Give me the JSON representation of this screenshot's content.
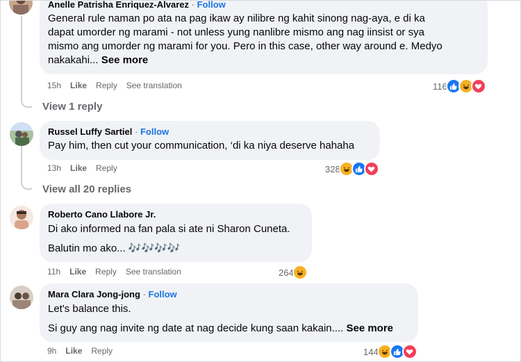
{
  "comments": [
    {
      "author": "Anelle Patrisha Enriquez-Alvarez",
      "dot": "·",
      "follow": "Follow",
      "lines": [
        "General rule naman po ata na pag ikaw ay nilibre ng kahit sinong nag-aya, e di ka",
        "dapat umorder ng marami - not unless yung nanlibre mismo ang nag iinsist or sya",
        "mismo ang umorder ng marami for you. Pero in this case, other way around e. Medyo",
        "nakakahi..."
      ],
      "see_more": "See more",
      "time": "15h",
      "like": "Like",
      "reply": "Reply",
      "translate": "See translation",
      "reaction_count": "116",
      "reactions": [
        "like-icon",
        "haha-icon",
        "love-icon"
      ]
    },
    {
      "author": "Russel Luffy Sartiel",
      "dot": "·",
      "follow": "Follow",
      "text": "Pay him, then cut your communication, ‘di ka niya deserve hahaha",
      "time": "13h",
      "like": "Like",
      "reply": "Reply",
      "reaction_count": "328",
      "reactions": [
        "haha-icon",
        "like-icon",
        "love-icon"
      ]
    },
    {
      "author": "Roberto Cano Llabore Jr.",
      "text1": "Di ako informed na fan pala si ate ni Sharon Cuneta.",
      "text2": "Balutin mo ako... 🎶🎶🎶🎶",
      "time": "11h",
      "like": "Like",
      "reply": "Reply",
      "translate": "See translation",
      "reaction_count": "264",
      "reactions": [
        "haha-icon"
      ]
    },
    {
      "author": "Mara Clara Jong-jong",
      "dot": "·",
      "follow": "Follow",
      "text1": "Let's balance this.",
      "text2": "Si guy ang nag invite ng date at nag decide kung saan kakain....",
      "see_more": "See more",
      "time": "9h",
      "like": "Like",
      "reply": "Reply",
      "reaction_count": "144",
      "reactions": [
        "haha-icon",
        "like-icon",
        "love-icon"
      ]
    }
  ],
  "view_replies": [
    "View 1 reply",
    "View all 20 replies"
  ],
  "colors": {
    "like": "#1877f2",
    "love": "#f33e58",
    "haha": "#f7b125",
    "follow": "#1b74e4",
    "bubble": "#f0f2f5"
  }
}
